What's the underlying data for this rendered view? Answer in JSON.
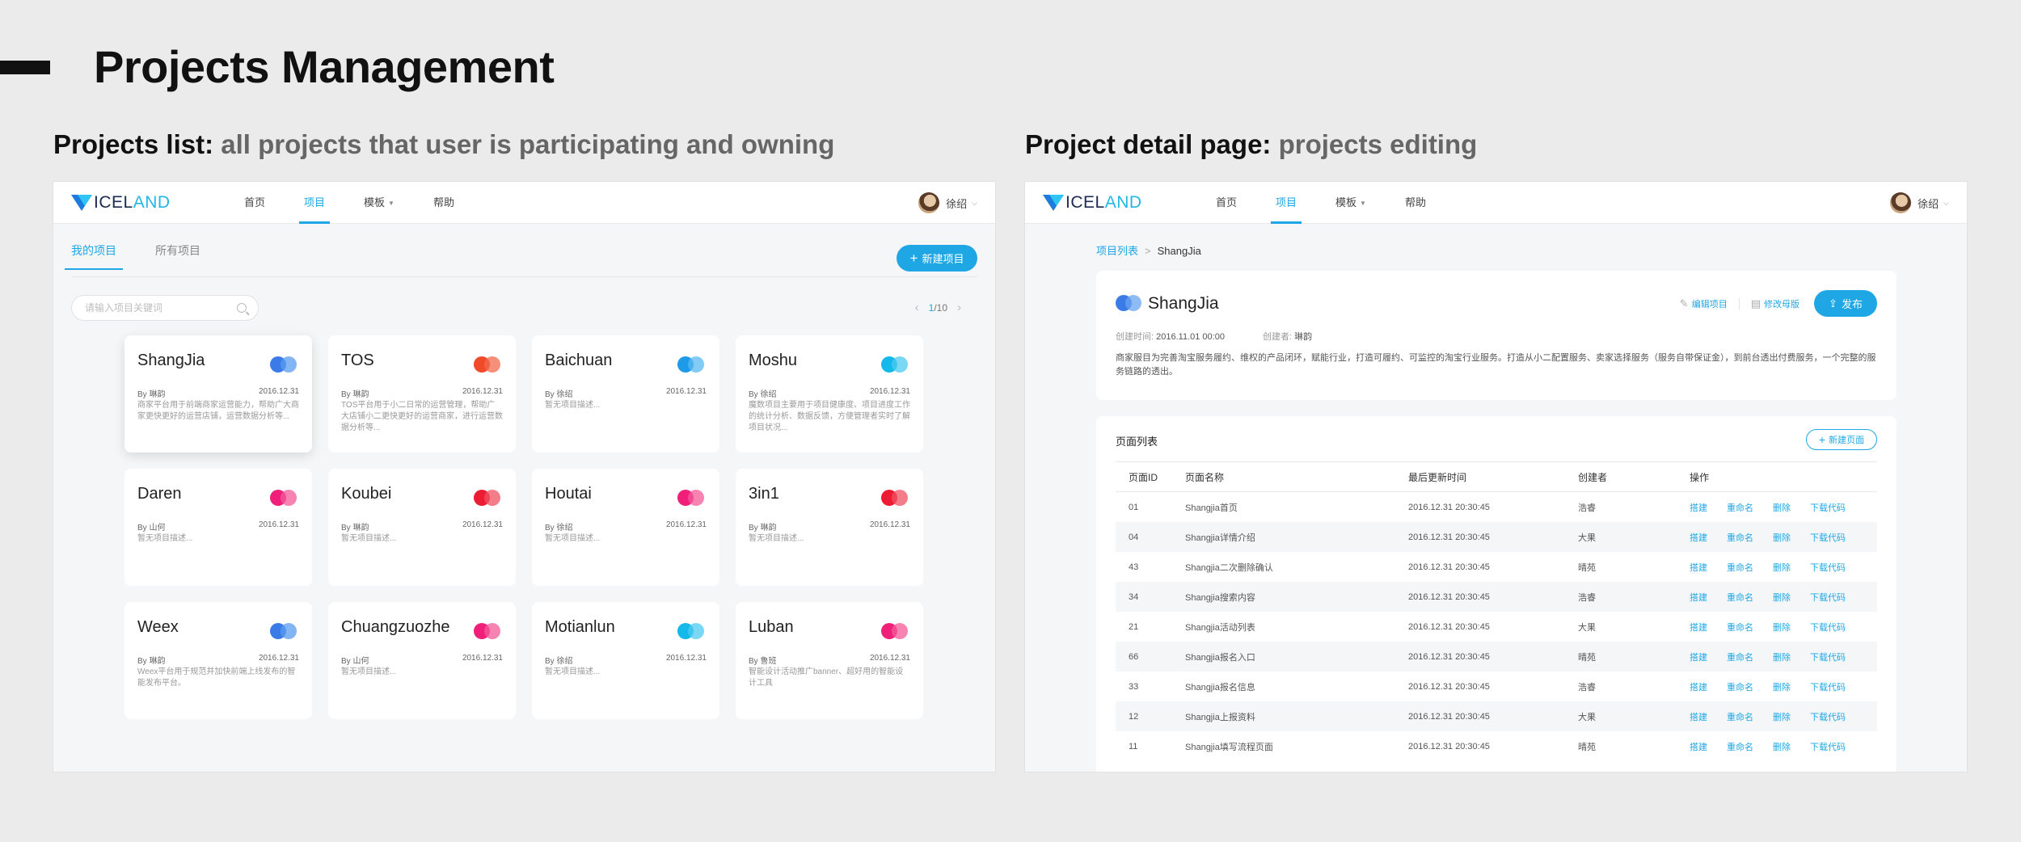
{
  "page": {
    "title": "Projects Management",
    "left_heading_bold": "Projects list:",
    "left_heading_sub": "all projects that user is participating and owning",
    "right_heading_bold": "Project detail page:",
    "right_heading_sub": "projects editing"
  },
  "app": {
    "logo_dark": "ICEL",
    "logo_accent": "AND",
    "nav": [
      "首页",
      "项目",
      "模板",
      "帮助"
    ],
    "active_nav": "项目",
    "user_name": "徐绍"
  },
  "list_page": {
    "tabs": [
      "我的项目",
      "所有项目"
    ],
    "new_project_label": "新建项目",
    "search_placeholder": "请输入项目关键词",
    "pager_current": "1",
    "pager_total": "/10",
    "projects": [
      {
        "name": "ShangJia",
        "owner": "By 琳韵",
        "date": "2016.12.31",
        "desc": "商家平台用于前端商家运营能力，帮助广大商家更快更好的运营店铺，运营数据分析等...",
        "colors": [
          "#3b7be8",
          "#5a9cf0"
        ]
      },
      {
        "name": "TOS",
        "owner": "By 琳韵",
        "date": "2016.12.31",
        "desc": "TOS平台用于小二日常的运营管理，帮助广大店铺小二更快更好的运营商家，进行运营数据分析等...",
        "colors": [
          "#f04a2a",
          "#f26a4e"
        ]
      },
      {
        "name": "Baichuan",
        "owner": "By 徐绍",
        "date": "2016.12.31",
        "desc": "暂无项目描述...",
        "colors": [
          "#1d9ae8",
          "#5ab8f2"
        ]
      },
      {
        "name": "Moshu",
        "owner": "By 徐绍",
        "date": "2016.12.31",
        "desc": "魔数项目主要用于项目健康度、项目进度工作的统计分析、数据反馈，方便管理者实时了解项目状况...",
        "colors": [
          "#12b9ea",
          "#4fcbf0"
        ]
      },
      {
        "name": "Daren",
        "owner": "By 山何",
        "date": "2016.12.31",
        "desc": "暂无项目描述...",
        "colors": [
          "#f0207a",
          "#f45a9a"
        ]
      },
      {
        "name": "Koubei",
        "owner": "By 琳韵",
        "date": "2016.12.31",
        "desc": "暂无项目描述...",
        "colors": [
          "#ec1c34",
          "#f05263"
        ]
      },
      {
        "name": "Houtai",
        "owner": "By 徐绍",
        "date": "2016.12.31",
        "desc": "暂无项目描述...",
        "colors": [
          "#f0207a",
          "#f45a9a"
        ]
      },
      {
        "name": "3in1",
        "owner": "By 琳韵",
        "date": "2016.12.31",
        "desc": "暂无项目描述...",
        "colors": [
          "#ec1c34",
          "#f05263"
        ]
      },
      {
        "name": "Weex",
        "owner": "By 琳韵",
        "date": "2016.12.31",
        "desc": "Weex平台用于规范并加快前端上线发布的智能发布平台。",
        "colors": [
          "#3b7be8",
          "#5a9cf0"
        ]
      },
      {
        "name": "Chuangzuozhe",
        "owner": "By 山何",
        "date": "2016.12.31",
        "desc": "暂无项目描述...",
        "colors": [
          "#f0207a",
          "#f45a9a"
        ]
      },
      {
        "name": "Motianlun",
        "owner": "By 徐绍",
        "date": "2016.12.31",
        "desc": "暂无项目描述...",
        "colors": [
          "#12b9ea",
          "#4fcbf0"
        ]
      },
      {
        "name": "Luban",
        "owner": "By 鲁班",
        "date": "2016.12.31",
        "desc": "智能设计活动推广banner、超好用的智能设计工具",
        "colors": [
          "#f0207a",
          "#f45a9a"
        ]
      }
    ]
  },
  "detail_page": {
    "breadcrumb_root": "项目列表",
    "breadcrumb_sep": ">",
    "breadcrumb_current": "ShangJia",
    "project_name": "ShangJia",
    "project_colors": [
      "#3b7be8",
      "#6aa4f2"
    ],
    "edit_label": "编辑项目",
    "modify_label": "修改母版",
    "publish_label": "发布",
    "created_time_label": "创建时间:",
    "created_time": "2016.11.01  00:00",
    "creator_label": "创建者:",
    "creator": "琳韵",
    "description": "商家服目为完善淘宝服务履约、维权的产品闭环，赋能行业，打造可履约、可监控的淘宝行业服务。打造从小二配置服务、卖家选择服务（服务自带保证金），到前台透出付费服务，一个完整的服务链路的透出。",
    "list_title": "页面列表",
    "new_page_label": "新建页面",
    "columns": [
      "页面ID",
      "页面名称",
      "最后更新时间",
      "创建者",
      "操作"
    ],
    "actions": [
      "搭建",
      "重命名",
      "删除",
      "下载代码"
    ],
    "rows": [
      {
        "id": "01",
        "name": "Shangjia首页",
        "time": "2016.12.31  20:30:45",
        "creator": "浩睿"
      },
      {
        "id": "04",
        "name": "Shangjia详情介绍",
        "time": "2016.12.31  20:30:45",
        "creator": "大果"
      },
      {
        "id": "43",
        "name": "Shangjia二次删除确认",
        "time": "2016.12.31  20:30:45",
        "creator": "晴苑"
      },
      {
        "id": "34",
        "name": "Shangjia搜索内容",
        "time": "2016.12.31  20:30:45",
        "creator": "浩睿"
      },
      {
        "id": "21",
        "name": "Shangjia活动列表",
        "time": "2016.12.31  20:30:45",
        "creator": "大果"
      },
      {
        "id": "66",
        "name": "Shangjia报名入口",
        "time": "2016.12.31  20:30:45",
        "creator": "晴苑"
      },
      {
        "id": "33",
        "name": "Shangjia报名信息",
        "time": "2016.12.31  20:30:45",
        "creator": "浩睿"
      },
      {
        "id": "12",
        "name": "Shangjia上报资料",
        "time": "2016.12.31  20:30:45",
        "creator": "大果"
      },
      {
        "id": "11",
        "name": "Shangjia填写流程页面",
        "time": "2016.12.31  20:30:45",
        "creator": "晴苑"
      }
    ]
  }
}
